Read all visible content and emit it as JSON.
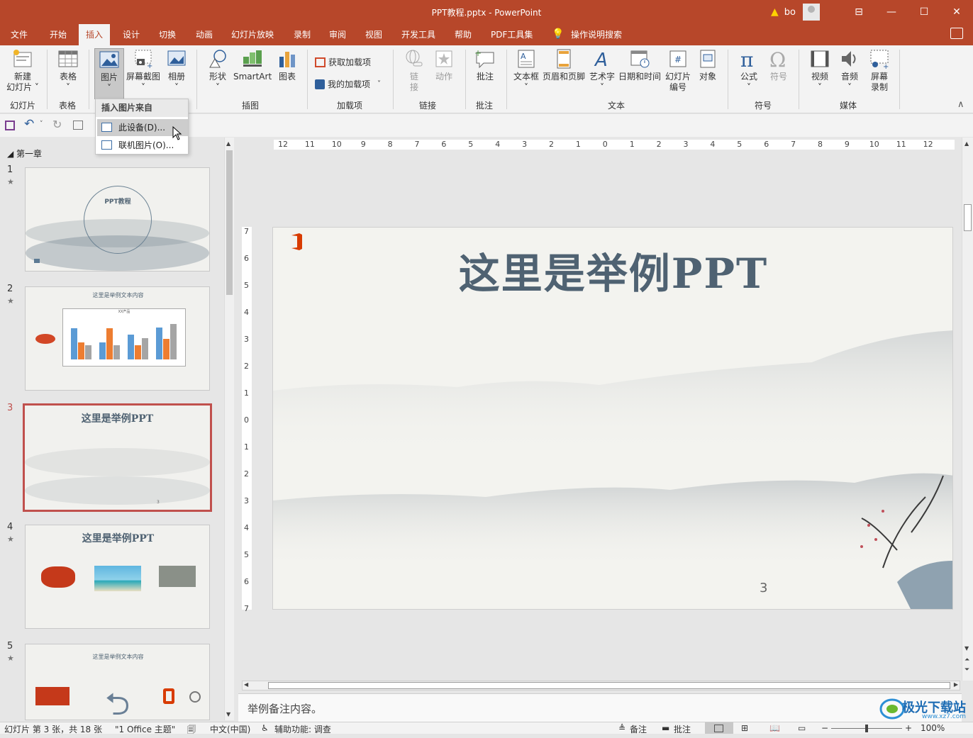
{
  "window": {
    "title": "PPT教程.pptx  -  PowerPoint",
    "user": "bo",
    "controls": [
      "⊟",
      "—",
      "☐",
      "✕"
    ]
  },
  "tabs": [
    "文件",
    "开始",
    "插入",
    "设计",
    "切换",
    "动画",
    "幻灯片放映",
    "录制",
    "审阅",
    "视图",
    "开发工具",
    "帮助",
    "PDF工具集",
    "操作说明搜索"
  ],
  "active_tab": "插入",
  "ribbon": {
    "new_slide": {
      "line1": "新建",
      "line2": "幻灯片 ˅"
    },
    "table": "表格",
    "picture": "图片",
    "screenshot": "屏幕截图",
    "album": "相册",
    "shapes": "形状",
    "smartart": "SmartArt",
    "chart": "图表",
    "get_addins": "获取加载项",
    "my_addins": "我的加载项",
    "link": {
      "line1": "链",
      "line2": "接"
    },
    "action": "动作",
    "comment": "批注",
    "textbox": "文本框",
    "header_footer": "页眉和页脚",
    "wordart": "艺术字",
    "datetime": "日期和时间",
    "slide_number": {
      "line1": "幻灯片",
      "line2": "编号"
    },
    "object": "对象",
    "equation": "公式",
    "symbol": "符号",
    "video": "视频",
    "audio": "音频",
    "screen_record": {
      "line1": "屏幕",
      "line2": "录制"
    },
    "groups": {
      "slides": "幻灯片",
      "tables": "表格",
      "illustrations": "插图",
      "addins": "加载项",
      "links": "链接",
      "comments": "批注",
      "text": "文本",
      "symbols": "符号",
      "media": "媒体"
    }
  },
  "dropdown": {
    "header": "插入图片来自",
    "items": [
      "此设备(D)...",
      "联机图片(O)..."
    ]
  },
  "thumbnails": {
    "section": "第一章",
    "slides": [
      {
        "num": "1",
        "title": "PPT教程"
      },
      {
        "num": "2",
        "title": "这里是举例文本内容",
        "chart_title": "XX产品"
      },
      {
        "num": "3",
        "title": "这里是举例PPT",
        "page": "3"
      },
      {
        "num": "4",
        "title": "这里是举例PPT"
      },
      {
        "num": "5",
        "title": "这里是举例文本内容"
      }
    ]
  },
  "ruler": {
    "h_ticks": [
      "12",
      "11",
      "10",
      "9",
      "8",
      "7",
      "6",
      "5",
      "4",
      "3",
      "2",
      "1",
      "0",
      "1",
      "2",
      "3",
      "4",
      "5",
      "6",
      "7",
      "8",
      "9",
      "10",
      "11",
      "12"
    ],
    "v_ticks": [
      "7",
      "6",
      "5",
      "4",
      "3",
      "2",
      "1",
      "0",
      "1",
      "2",
      "3",
      "4",
      "5",
      "6",
      "7"
    ]
  },
  "slide": {
    "title": "这里是举例PPT",
    "page_number": "3"
  },
  "notes": "举例备注内容。",
  "status": {
    "slide_info": "幻灯片 第 3 张，共 18 张",
    "theme": "\"1 Office 主题\"",
    "language": "中文(中国)",
    "accessibility": "辅助功能: 调查",
    "notes_btn": "备注",
    "comments_btn": "批注",
    "zoom": "100%"
  },
  "watermark": {
    "brand": "极光下载站",
    "url": "www.xz7.com"
  },
  "colors": {
    "accent": "#b7472a",
    "slide_title": "#4f6272",
    "selected_border": "#c0504d"
  }
}
